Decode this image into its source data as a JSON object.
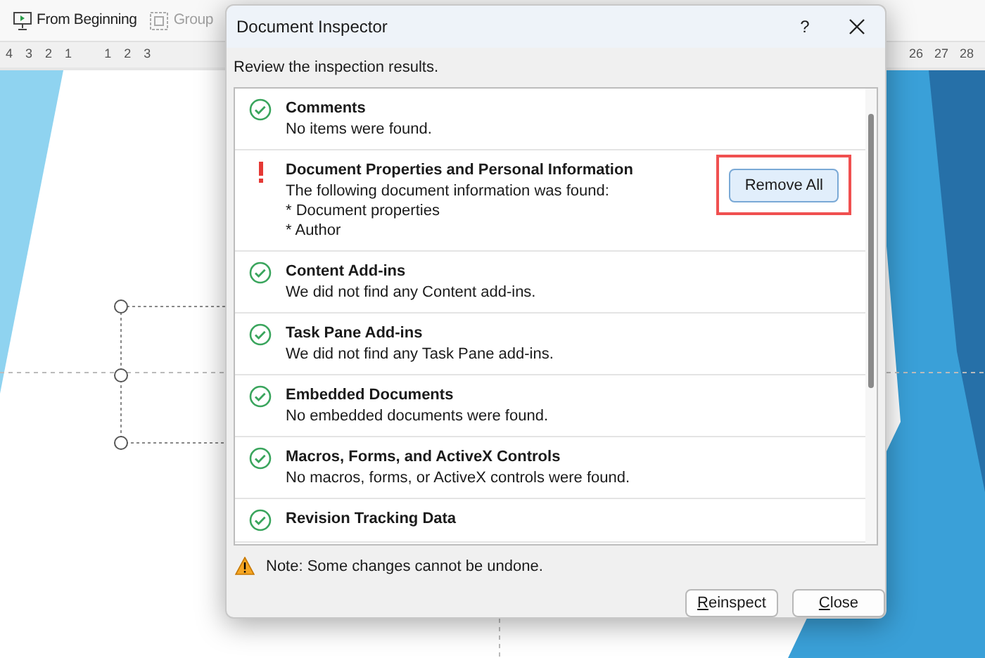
{
  "toolbar": {
    "items": [
      {
        "label": "From Beginning",
        "disabled": false
      },
      {
        "label": "Group",
        "disabled": true
      }
    ]
  },
  "ruler": {
    "left_labels": [
      "4",
      "3",
      "2",
      "1",
      "1",
      "2",
      "3"
    ],
    "right_labels": [
      "26",
      "27",
      "28"
    ]
  },
  "dialog": {
    "title": "Document Inspector",
    "help": "?",
    "intro": "Review the inspection results.",
    "results": [
      {
        "kind": "clean",
        "title": "Comments",
        "lines": [
          "No items were found."
        ]
      },
      {
        "kind": "found",
        "title": "Document Properties and Personal Information",
        "lines": [
          "The following document information was found:",
          "* Document properties",
          "* Author"
        ],
        "action": {
          "label": "Remove All",
          "highlighted": true
        }
      },
      {
        "kind": "clean",
        "title": "Content Add-ins",
        "lines": [
          "We did not find any Content add-ins."
        ]
      },
      {
        "kind": "clean",
        "title": "Task Pane Add-ins",
        "lines": [
          "We did not find any Task Pane add-ins."
        ]
      },
      {
        "kind": "clean",
        "title": "Embedded Documents",
        "lines": [
          "No embedded documents were found."
        ]
      },
      {
        "kind": "clean",
        "title": "Macros, Forms, and ActiveX Controls",
        "lines": [
          "No macros, forms, or ActiveX controls were found."
        ]
      },
      {
        "kind": "clean",
        "title": "Revision Tracking Data"
      }
    ],
    "note": "Note: Some changes cannot be undone.",
    "buttons": [
      "Reinspect",
      "Close"
    ]
  }
}
